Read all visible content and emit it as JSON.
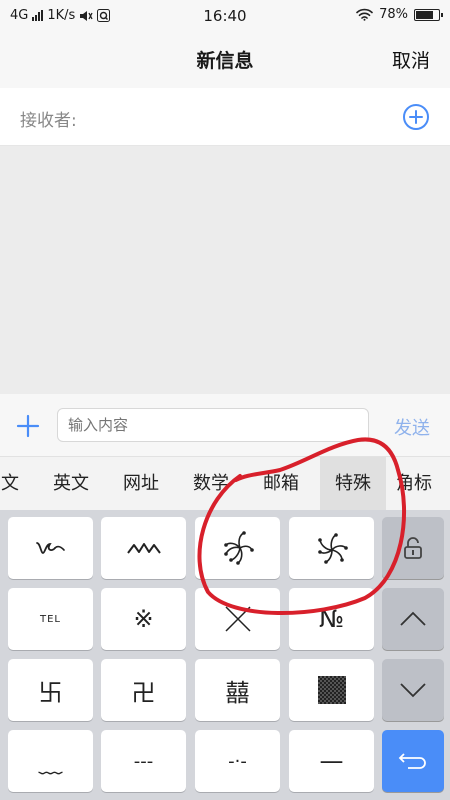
{
  "status_bar": {
    "network": "4G",
    "speed": "1K/s",
    "time": "16:40",
    "battery": "78%",
    "battery_level": 0.78,
    "icons": [
      "signal-icon",
      "mute-icon",
      "app-notification-icon",
      "wifi-icon",
      "battery-icon"
    ]
  },
  "nav": {
    "title": "新信息",
    "cancel": "取消"
  },
  "recipient": {
    "label": "接收者:",
    "add_icon": "plus-circle-icon"
  },
  "input_bar": {
    "add_icon": "plus-icon",
    "placeholder": "输入内容",
    "send": "发送"
  },
  "categories": {
    "tabs": [
      "文",
      "英文",
      "网址",
      "数学",
      "邮箱",
      "特殊",
      "角标"
    ],
    "active": "特殊"
  },
  "keyboard": {
    "rows": [
      [
        "℘",
        "ᨓ",
        "firework-1",
        "firework-2"
      ],
      [
        "TEL",
        "※",
        "╳",
        "№"
      ],
      [
        "卐",
        "卍",
        "囍",
        "▩"
      ],
      [
        "﹏",
        "---",
        "-·-",
        "—"
      ]
    ],
    "side_keys": [
      "lock-icon",
      "chevron-up-icon",
      "chevron-down-icon",
      "return-icon"
    ]
  },
  "colors": {
    "accent": "#4a8df8",
    "send_disabled": "#8fb2ec",
    "annotation": "#d8202b"
  }
}
